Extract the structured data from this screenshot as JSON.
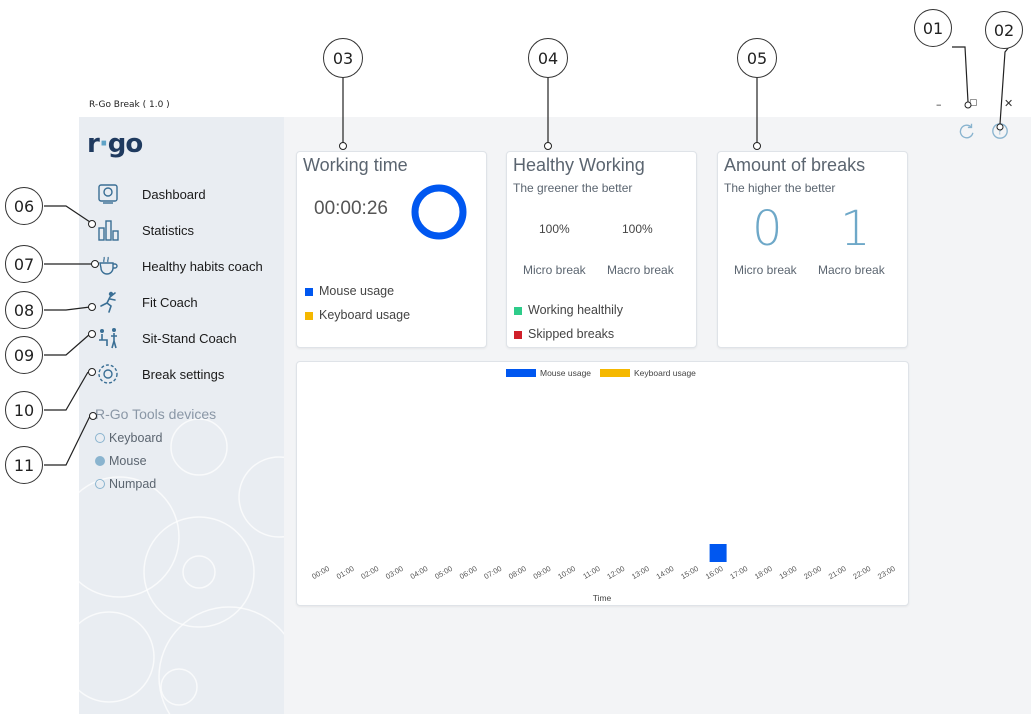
{
  "window": {
    "title": "R-Go Break ( 1.0 )",
    "minimize": "–",
    "restore": "▢",
    "close": "✕"
  },
  "logo": {
    "prefix": "r",
    "dot": "·",
    "suffix": "go"
  },
  "toolbar": {
    "refresh_icon": "refresh-icon",
    "help_icon": "help-icon"
  },
  "sidebar": {
    "items": [
      {
        "label": "Dashboard",
        "icon": "dashboard-icon"
      },
      {
        "label": "Statistics",
        "icon": "statistics-icon"
      },
      {
        "label": "Healthy habits coach",
        "icon": "coffee-cup-icon"
      },
      {
        "label": "Fit Coach",
        "icon": "stretching-person-icon"
      },
      {
        "label": "Sit-Stand Coach",
        "icon": "sit-stand-icon"
      },
      {
        "label": "Break settings",
        "icon": "gear-icon"
      }
    ],
    "devices_title": "R-Go Tools devices",
    "devices": [
      {
        "label": "Keyboard",
        "selected": false
      },
      {
        "label": "Mouse",
        "selected": true
      },
      {
        "label": "Numpad",
        "selected": false
      }
    ]
  },
  "working_time": {
    "title": "Working time",
    "time": "00:00:26",
    "legend": [
      "Mouse usage",
      "Keyboard usage"
    ]
  },
  "healthy_working": {
    "title": "Healthy Working",
    "subtitle": "The greener the better",
    "micro_pct": "100%",
    "macro_pct": "100%",
    "micro_label": "Micro break",
    "macro_label": "Macro break",
    "legend": [
      "Working healthily",
      "Skipped breaks"
    ]
  },
  "amount_breaks": {
    "title": "Amount of breaks",
    "subtitle": "The higher the better",
    "micro_count": "0",
    "macro_count": "1",
    "micro_label": "Micro break",
    "macro_label": "Macro break"
  },
  "callouts": [
    "01",
    "02",
    "03",
    "04",
    "05",
    "06",
    "07",
    "08",
    "09",
    "10",
    "11"
  ],
  "colors": {
    "mouse": "#0057f0",
    "keyboard": "#f5b800",
    "healthy": "#2ecc8a",
    "skipped": "#d0202a",
    "accent": "#6ea8c8"
  },
  "chart_data": {
    "type": "bar",
    "series": [
      {
        "name": "Mouse usage",
        "values": [
          0,
          0,
          0,
          0,
          0,
          0,
          0,
          0,
          0,
          0,
          0,
          0,
          0,
          0,
          0,
          0,
          1,
          0,
          0,
          0,
          0,
          0,
          0,
          0
        ]
      },
      {
        "name": "Keyboard usage",
        "values": [
          0,
          0,
          0,
          0,
          0,
          0,
          0,
          0,
          0,
          0,
          0,
          0,
          0,
          0,
          0,
          0,
          0,
          0,
          0,
          0,
          0,
          0,
          0,
          0
        ]
      }
    ],
    "categories": [
      "00:00",
      "01:00",
      "02:00",
      "03:00",
      "04:00",
      "05:00",
      "06:00",
      "07:00",
      "08:00",
      "09:00",
      "10:00",
      "11:00",
      "12:00",
      "13:00",
      "14:00",
      "15:00",
      "16:00",
      "17:00",
      "18:00",
      "19:00",
      "20:00",
      "21:00",
      "22:00",
      "23:00"
    ],
    "xlabel": "Time",
    "ylabel": "",
    "legend": "top-center"
  }
}
